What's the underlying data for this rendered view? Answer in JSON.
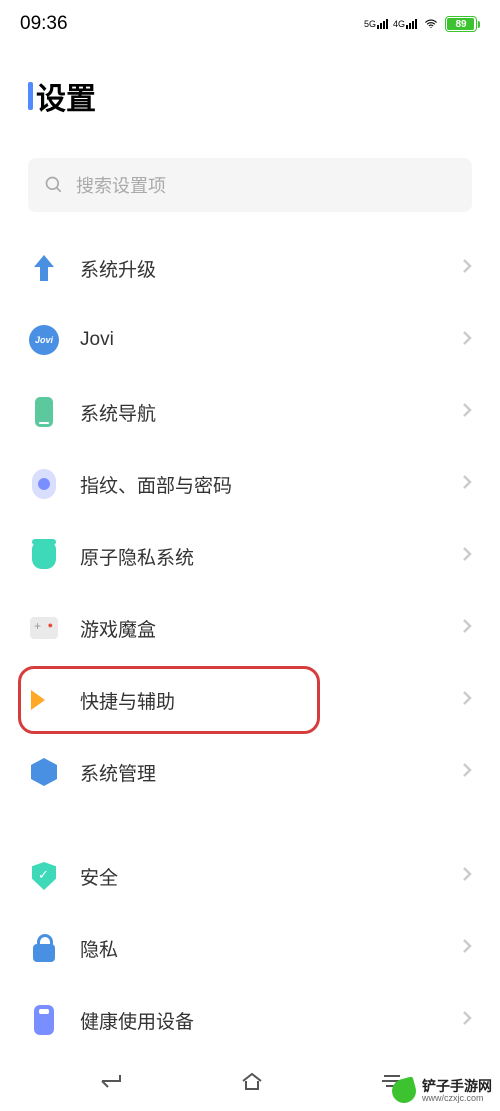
{
  "status": {
    "time": "09:36",
    "signal1_label": "5G",
    "signal2_label": "4G",
    "battery_percent": "89"
  },
  "header": {
    "title": "设置"
  },
  "search": {
    "placeholder": "搜索设置项"
  },
  "groups": [
    {
      "items": [
        {
          "id": "system-upgrade",
          "label": "系统升级",
          "icon": "upgrade"
        },
        {
          "id": "jovi",
          "label": "Jovi",
          "icon": "jovi"
        },
        {
          "id": "system-nav",
          "label": "系统导航",
          "icon": "nav"
        },
        {
          "id": "biometrics",
          "label": "指纹、面部与密码",
          "icon": "fingerprint"
        },
        {
          "id": "privacy-system",
          "label": "原子隐私系统",
          "icon": "privacy"
        },
        {
          "id": "gamebox",
          "label": "游戏魔盒",
          "icon": "gamebox"
        },
        {
          "id": "shortcuts",
          "label": "快捷与辅助",
          "icon": "shortcut",
          "highlighted": true
        },
        {
          "id": "system-mgmt",
          "label": "系统管理",
          "icon": "sysmgmt"
        }
      ]
    },
    {
      "items": [
        {
          "id": "security",
          "label": "安全",
          "icon": "security"
        },
        {
          "id": "privacy",
          "label": "隐私",
          "icon": "lock"
        },
        {
          "id": "digital-wellbeing",
          "label": "健康使用设备",
          "icon": "health"
        }
      ]
    }
  ],
  "watermark": {
    "brand": "铲子手游网",
    "url": "www/czxjc.com"
  },
  "icons": {
    "jovi_text": "Jovi"
  }
}
